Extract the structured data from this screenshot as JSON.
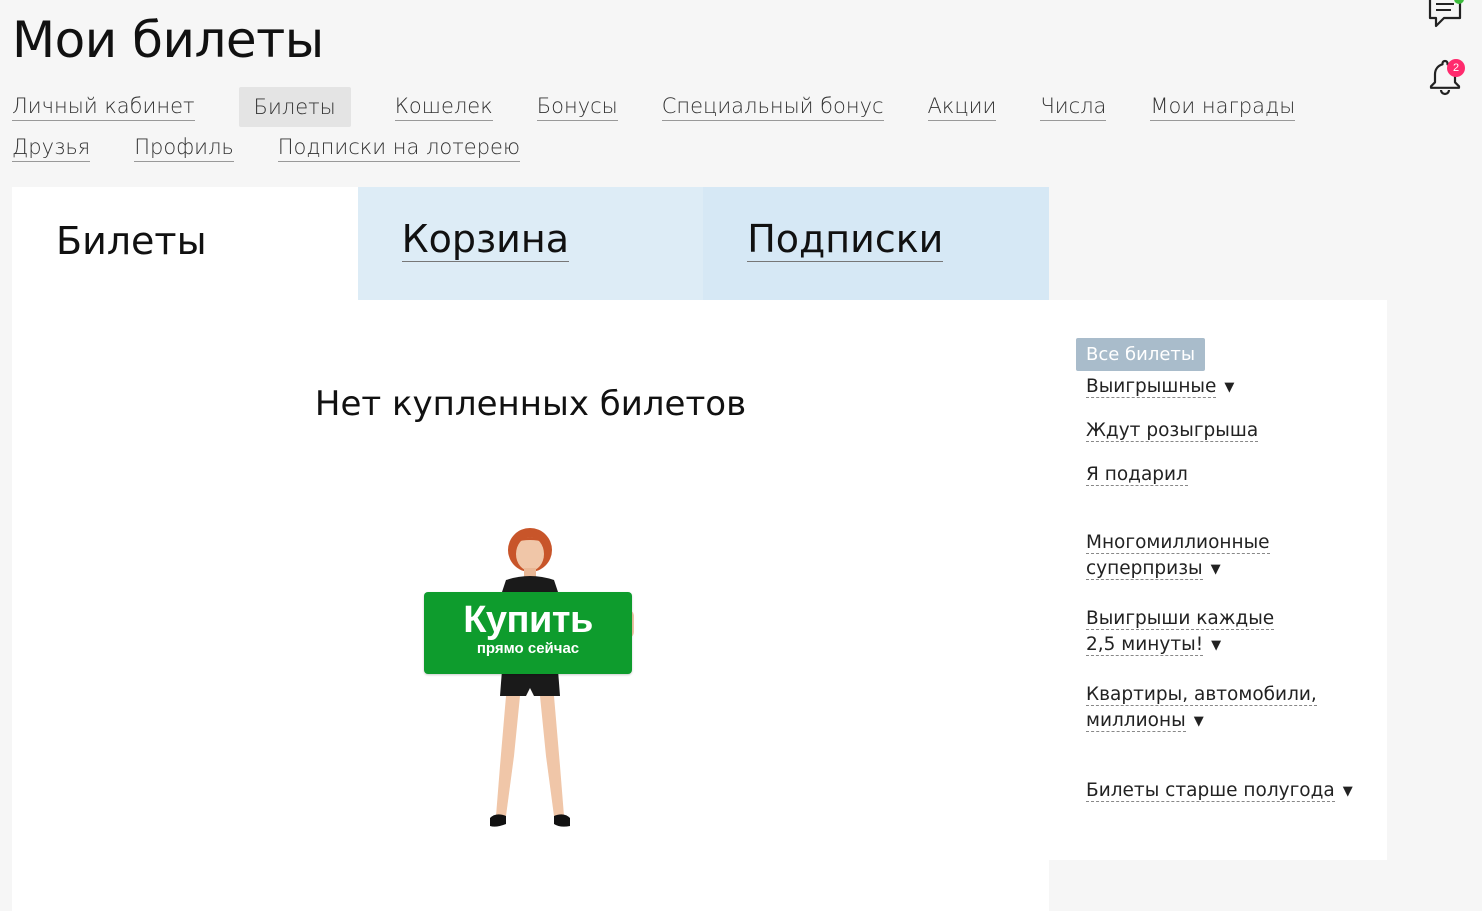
{
  "page": {
    "title": "Мои билеты"
  },
  "header": {
    "notification_count": "2"
  },
  "nav": {
    "row1": [
      {
        "label": "Личный кабинет",
        "active": false
      },
      {
        "label": "Билеты",
        "active": true
      },
      {
        "label": "Кошелек",
        "active": false
      },
      {
        "label": "Бонусы",
        "active": false
      },
      {
        "label": "Специальный бонус",
        "active": false
      },
      {
        "label": "Акции",
        "active": false
      },
      {
        "label": "Числа",
        "active": false
      },
      {
        "label": "Мои награды",
        "active": false
      }
    ],
    "row2": [
      {
        "label": "Друзья",
        "active": false
      },
      {
        "label": "Профиль",
        "active": false
      },
      {
        "label": "Подписки на лотерею",
        "active": false
      }
    ]
  },
  "tabs": [
    {
      "label": "Билеты",
      "active": true
    },
    {
      "label": "Корзина",
      "active": false
    },
    {
      "label": "Подписки",
      "active": false
    }
  ],
  "main": {
    "empty_message": "Нет купленных билетов",
    "buy_button": {
      "label": "Купить",
      "sublabel": "прямо сейчас"
    }
  },
  "filters": {
    "all": "Все билеты",
    "items": [
      {
        "line1": "Выигрышные",
        "line2": "",
        "dropdown": true
      },
      {
        "line1": "Ждут розыгрыша",
        "line2": "",
        "dropdown": false
      },
      {
        "line1": "Я подарил",
        "line2": "",
        "dropdown": false
      },
      {
        "line1": "Многомиллионные",
        "line2": "суперпризы",
        "dropdown": true
      },
      {
        "line1": "Выигрыши каждые",
        "line2": "2,5 минуты!",
        "dropdown": true
      },
      {
        "line1": "Квартиры, автомобили,",
        "line2": "миллионы",
        "dropdown": true
      },
      {
        "line1": "Билеты старше полугода",
        "line2": "",
        "dropdown": true
      }
    ]
  },
  "colors": {
    "buy_button": "#0e9c2d",
    "tab_inactive": "#ddecf6",
    "filter_active_bg": "#a9bccb",
    "badge": "#ff2a6d",
    "chat_dot": "#3cbb3c"
  }
}
